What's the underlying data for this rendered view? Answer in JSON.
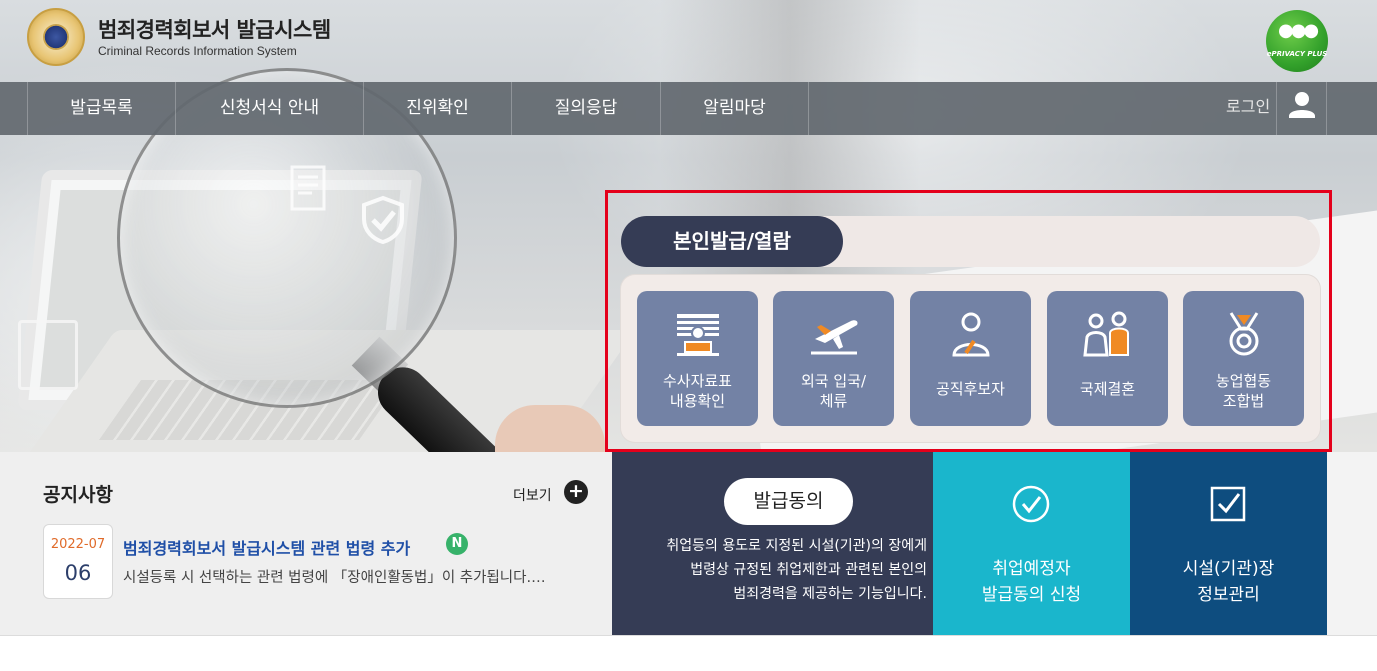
{
  "header": {
    "title": "범죄경력회보서 발급시스템",
    "subtitle": "Criminal Records Information System",
    "privacy_badge": "ePRIVACY PLUS"
  },
  "nav": {
    "items": [
      {
        "label": "발급목록"
      },
      {
        "label": "신청서식 안내"
      },
      {
        "label": "진위확인"
      },
      {
        "label": "질의응답"
      },
      {
        "label": "알림마당"
      }
    ],
    "login_label": "로그인"
  },
  "issue_panel": {
    "tab_label": "본인발급/열람",
    "cards": [
      {
        "label": "수사자료표\n내용확인",
        "icon": "document-person-icon"
      },
      {
        "label": "외국 입국/\n체류",
        "icon": "airplane-icon"
      },
      {
        "label": "공직후보자",
        "icon": "candidate-icon"
      },
      {
        "label": "국제결혼",
        "icon": "couple-icon"
      },
      {
        "label": "농업협동\n조합법",
        "icon": "medal-icon"
      }
    ]
  },
  "notice": {
    "title": "공지사항",
    "more_label": "더보기",
    "more_icon": "+",
    "item": {
      "date_ym": "2022-07",
      "date_d": "06",
      "headline": "범죄경력회보서 발급시스템 관련 법령 추가",
      "badge": "N",
      "body": "시설등록 시 선택하는 관련 법령에 「장애인활동법」이 추가됩니다.…"
    }
  },
  "consent": {
    "button_label": "발급동의",
    "description": "취업등의 용도로 지정된 시설(기관)의 장에게\n법령상 규정된 취업제한과 관련된 본인의\n범죄경력을 제공하는 기능입니다."
  },
  "tiles": {
    "job_applicant": "취업예정자\n발급동의 신청",
    "facility": "시설(기관)장\n정보관리"
  },
  "colors": {
    "nav_bg": "#62686f",
    "panel_dark": "#353c55",
    "card_bg": "#7382a5",
    "accent_orange": "#f08a24",
    "highlight_red": "#e4001b",
    "cyan": "#1ab6cc",
    "navy": "#0e4d7f",
    "badge_green": "#37b26a"
  }
}
